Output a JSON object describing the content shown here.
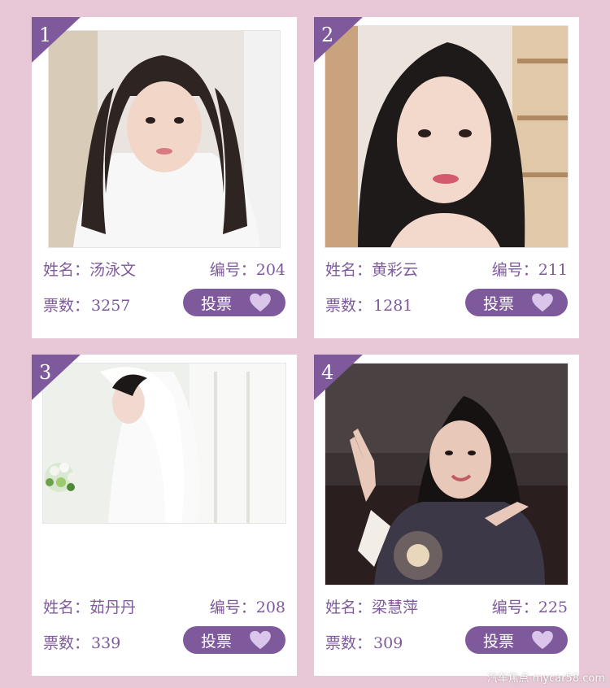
{
  "labels": {
    "name_label": "姓名：",
    "number_label": "编号：",
    "votes_label": "票数：",
    "vote_button": "投票"
  },
  "contestants": [
    {
      "rank": "1",
      "name": "汤泳文",
      "number": "204",
      "votes": "3257"
    },
    {
      "rank": "2",
      "name": "黄彩云",
      "number": "211",
      "votes": "1281"
    },
    {
      "rank": "3",
      "name": "茹丹丹",
      "number": "208",
      "votes": "339"
    },
    {
      "rank": "4",
      "name": "梁慧萍",
      "number": "225",
      "votes": "309"
    }
  ],
  "watermark": "汽车焦点  mycar58.com",
  "colors": {
    "background": "#e8c8d6",
    "accent": "#7e5a9c",
    "heart": "#d9c6ea",
    "card": "#ffffff"
  },
  "icons": {
    "vote_button_icon": "heart-icon",
    "rank_badge": "corner-ribbon"
  }
}
